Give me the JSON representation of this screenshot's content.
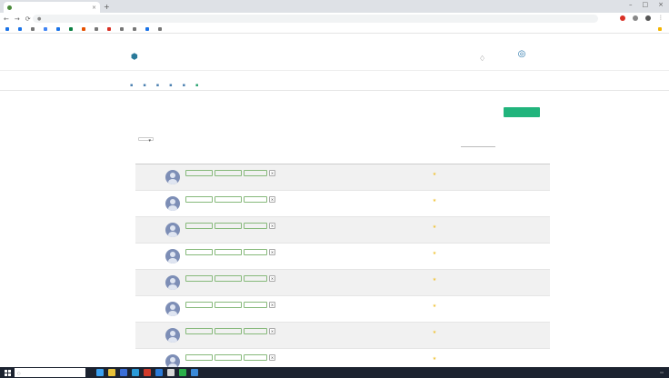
{
  "browser": {
    "tab_title": "",
    "address": "",
    "bookmarks": [
      "",
      "",
      "",
      "",
      "",
      "",
      "",
      "",
      "",
      "",
      "",
      "",
      ""
    ],
    "bookmark_colors": [
      "#1a73e8",
      "#1a73e8",
      "#777777",
      "#4285f4",
      "#1a73e8",
      "#0b8043",
      "#e65100",
      "#777777",
      "#d93025",
      "#777777",
      "#777777",
      "#1a73e8",
      "#777777"
    ],
    "other_bookmarks": ""
  },
  "header": {
    "app_title": "",
    "user_name": ""
  },
  "subnav": [
    "",
    "",
    "",
    "",
    "",
    ""
  ],
  "page": {
    "title": "",
    "add_label": "",
    "length_label": "",
    "length_value": "",
    "search_label": ""
  },
  "table": {
    "columns": [
      "",
      "",
      "",
      "",
      "",
      "",
      "",
      ""
    ],
    "chip_labels": [
      "",
      "",
      ""
    ],
    "rows": [
      {
        "id": "",
        "name": "",
        "email": "",
        "phone": "",
        "date": ""
      },
      {
        "id": "",
        "name": "",
        "email": "",
        "phone": "",
        "date": ""
      },
      {
        "id": "",
        "name": "",
        "email": "",
        "phone": "",
        "date": ""
      },
      {
        "id": "",
        "name": "",
        "email": "",
        "phone": "",
        "date": ""
      },
      {
        "id": "",
        "name": "",
        "email": "",
        "phone": "",
        "date": ""
      },
      {
        "id": "",
        "name": "",
        "email": "",
        "phone": "",
        "date": ""
      },
      {
        "id": "",
        "name": "",
        "email": "",
        "phone": "",
        "date": ""
      },
      {
        "id": "",
        "name": "",
        "email": "",
        "phone": "",
        "date": ""
      }
    ]
  },
  "taskbar": {
    "search_placeholder": "",
    "tray_items": [
      "",
      "",
      ""
    ],
    "app_colors": [
      "#3aa0f0",
      "#e8c23a",
      "#3a6fd8",
      "#2a9ad8",
      "#d03a2a",
      "#2a7ad8",
      "#d8d8d8",
      "#2ab04a",
      "#3a8ad8"
    ]
  },
  "colors": {
    "accent_green": "#21b47c",
    "link_blue": "#1e78a8"
  },
  "icons": {
    "back": "arrow-left-icon",
    "forward": "arrow-right-icon",
    "reload": "reload-icon",
    "notifications": "bell-icon",
    "user": "user-avatar-icon",
    "delete": "x-icon",
    "favorite": "star-icon"
  }
}
